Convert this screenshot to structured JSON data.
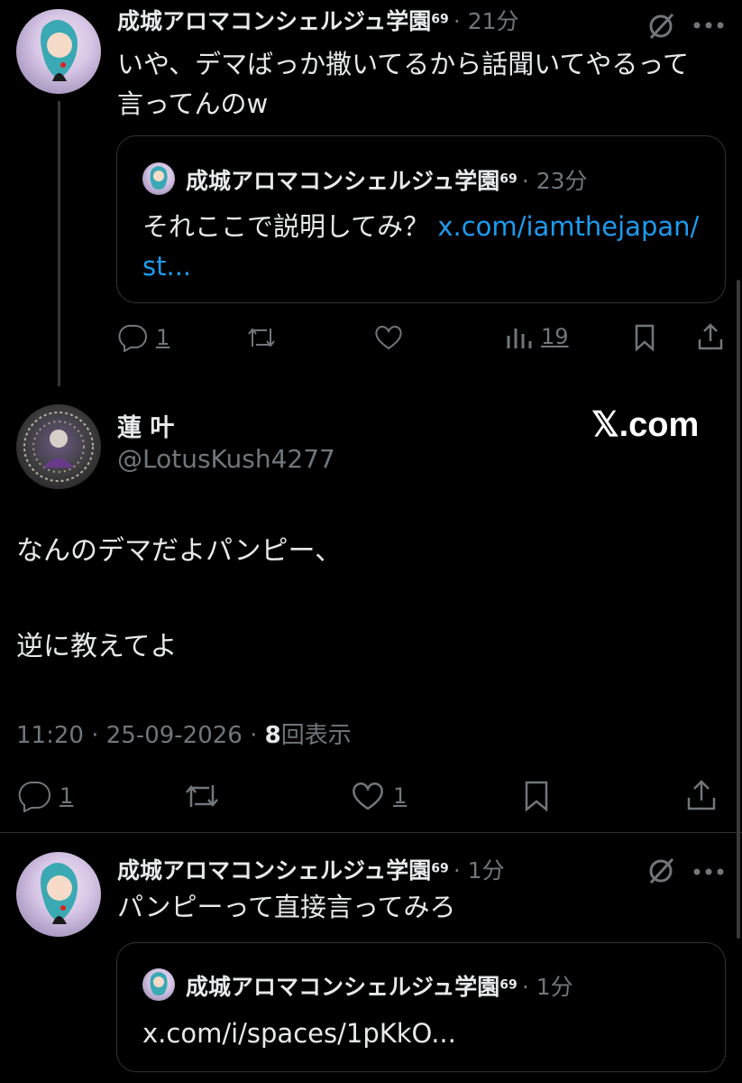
{
  "tweet1": {
    "author": "成城アロマコンシェルジュ学園",
    "badge": "69",
    "time": "· 21分",
    "text_line1": "いや、デマばっか撒いてるから話聞いてやるって",
    "text_line2": "言ってんのw",
    "quote": {
      "author": "成城アロマコンシェルジュ学園",
      "badge": "69",
      "time": "· 23分",
      "text": "それここで説明してみ？",
      "link_part1": "x.com/iamthejapan/",
      "link_part2": "st..."
    },
    "actions": {
      "reply_count": "1",
      "retweet_count": "",
      "like_count": "",
      "views_count": "19"
    }
  },
  "main_tweet": {
    "author": "蓮 叶",
    "handle": "@LotusKush4277",
    "brand": "𝕏.com",
    "text_line1": "なんのデマだよパンピー、",
    "text_line2": "逆に教えてよ",
    "timestamp": "11:20 · 25-09-2026 ·",
    "view_count": "8",
    "view_label": "回表示",
    "actions": {
      "reply_count": "1",
      "retweet_count": "",
      "like_count": "1"
    }
  },
  "tweet3": {
    "author": "成城アロマコンシェルジュ学園",
    "badge": "69",
    "time": "· 1分",
    "text": "パンピーって直接言ってみろ",
    "quote": {
      "author": "成城アロマコンシェルジュ学園",
      "badge": "69",
      "time": "· 1分",
      "link": "x.com/i/spaces/1pKkO..."
    }
  },
  "colors": {
    "background": "#000000",
    "text": "#e7e9ea",
    "muted": "#71767b",
    "link": "#1d9bf0",
    "border": "#2f3336"
  }
}
